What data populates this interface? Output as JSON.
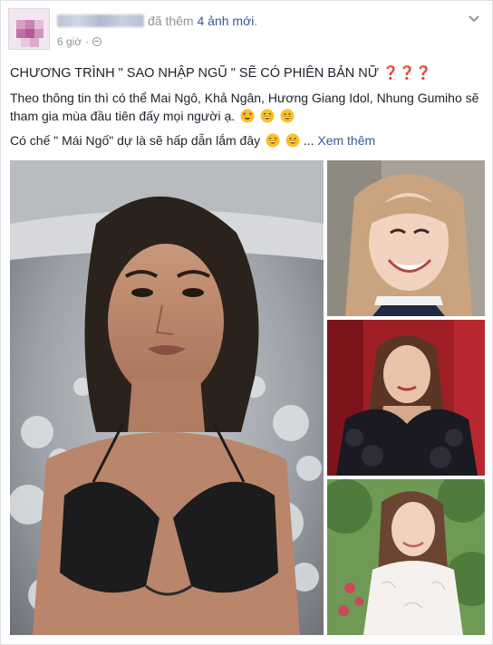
{
  "post": {
    "author_action": "đã thêm",
    "photo_count_link": "4 ảnh mới",
    "author_suffix": ".",
    "timestamp": "6 giờ",
    "privacy_icon": "globe-icon",
    "options_icon": "chevron-down-icon",
    "title_text": "CHƯƠNG TRÌNH \" SAO NHẬP NGŨ \" SẼ CÓ PHIÊN BẢN NỮ",
    "title_marks": "❓❓❓",
    "paragraph_1": "Theo thông tin thì có thể Mai Ngô, Khả Ngân, Hương Giang Idol, Nhung Gumiho sẽ tham gia mùa đầu tiên đấy mọi người ạ.",
    "paragraph_2": "Có chế \" Mái Ngố\" dự là sẽ hấp dẫn lắm đây",
    "ellipsis": "...",
    "see_more": "Xem thêm"
  },
  "colors": {
    "link": "#365899",
    "meta": "#90949c",
    "text": "#1d2129",
    "question_mark": "#e0245e"
  }
}
